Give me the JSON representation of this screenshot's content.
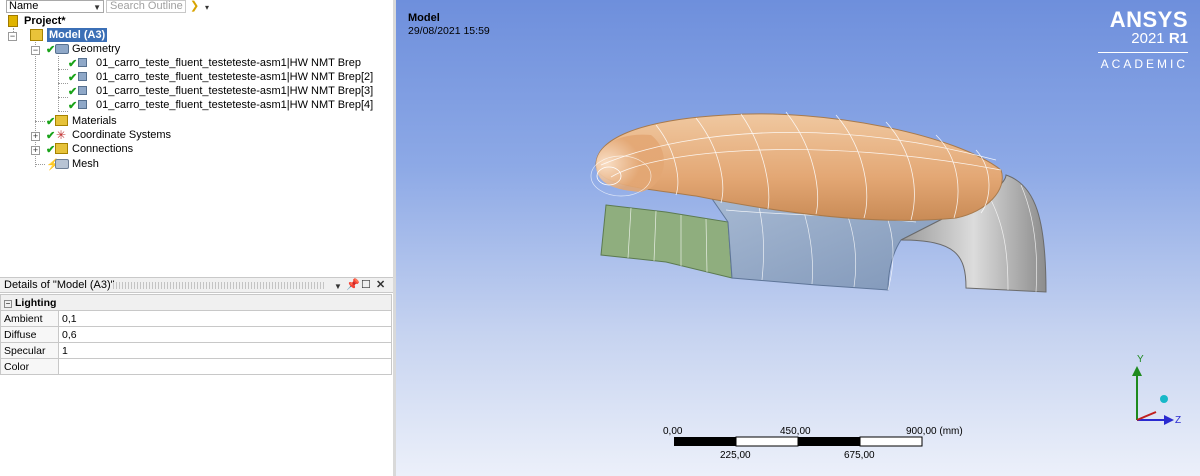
{
  "outline": {
    "name_filter": "Name",
    "search_placeholder": "Search Outline",
    "tree": {
      "project": "Project*",
      "model": "Model (A3)",
      "geometry": "Geometry",
      "bodies": [
        "01_carro_teste_fluent_testeteste-asm1|HW NMT Brep",
        "01_carro_teste_fluent_testeteste-asm1|HW NMT Brep[2]",
        "01_carro_teste_fluent_testeteste-asm1|HW NMT Brep[3]",
        "01_carro_teste_fluent_testeteste-asm1|HW NMT Brep[4]"
      ],
      "materials": "Materials",
      "coordinate_systems": "Coordinate Systems",
      "connections": "Connections",
      "mesh": "Mesh"
    }
  },
  "details": {
    "title": "Details of \"Model (A3)\"",
    "group": "Lighting",
    "rows": [
      {
        "key": "Ambient",
        "value": "0,1"
      },
      {
        "key": "Diffuse",
        "value": "0,6"
      },
      {
        "key": "Specular",
        "value": "1"
      },
      {
        "key": "Color",
        "value": ""
      }
    ]
  },
  "viewport": {
    "title": "Model",
    "date": "29/08/2021 15:59",
    "brand": {
      "name": "ANSYS",
      "year": "2021",
      "release": "R1",
      "edition": "ACADEMIC"
    },
    "scale": {
      "top_labels": [
        "0,00",
        "450,00",
        "900,00 (mm)"
      ],
      "bottom_labels": [
        "225,00",
        "675,00"
      ]
    },
    "axes": {
      "y": "Y",
      "z": "Z"
    }
  }
}
